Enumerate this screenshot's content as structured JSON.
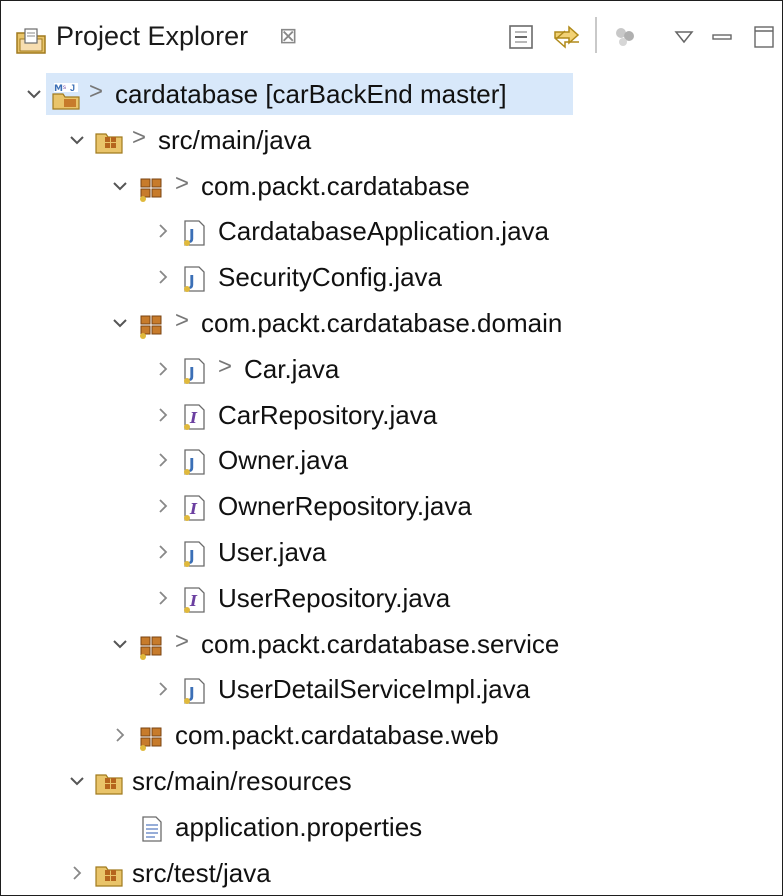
{
  "view": {
    "title": "Project Explorer",
    "close_glyph": "⊠",
    "toolbar": {
      "collapse_all": "collapse-all-icon",
      "link_with_editor": "link-with-editor-icon",
      "filters": "filters-icon",
      "view_menu": "view-menu-icon",
      "minimize": "minimize-icon",
      "maximize": "maximize-icon"
    }
  },
  "tree": {
    "rows": [
      {
        "label": "cardatabase [carBackEnd master]",
        "decoration": ">",
        "icon": "maven-project-icon",
        "expanded": true
      },
      {
        "label": "src/main/java",
        "decoration": ">",
        "icon": "source-folder-icon",
        "expanded": true
      },
      {
        "label": "com.packt.cardatabase",
        "decoration": ">",
        "icon": "package-icon",
        "expanded": true
      },
      {
        "label": "CardatabaseApplication.java",
        "decoration": "",
        "icon": "java-class-icon",
        "expanded": false
      },
      {
        "label": "SecurityConfig.java",
        "decoration": "",
        "icon": "java-class-icon",
        "expanded": false
      },
      {
        "label": "com.packt.cardatabase.domain",
        "decoration": ">",
        "icon": "package-icon",
        "expanded": true
      },
      {
        "label": "Car.java",
        "decoration": ">",
        "icon": "java-class-icon",
        "expanded": false
      },
      {
        "label": "CarRepository.java",
        "decoration": "",
        "icon": "java-interface-icon",
        "expanded": false
      },
      {
        "label": "Owner.java",
        "decoration": "",
        "icon": "java-class-icon",
        "expanded": false
      },
      {
        "label": "OwnerRepository.java",
        "decoration": "",
        "icon": "java-interface-icon",
        "expanded": false
      },
      {
        "label": "User.java",
        "decoration": "",
        "icon": "java-class-icon",
        "expanded": false
      },
      {
        "label": "UserRepository.java",
        "decoration": "",
        "icon": "java-interface-icon",
        "expanded": false
      },
      {
        "label": "com.packt.cardatabase.service",
        "decoration": ">",
        "icon": "package-icon",
        "expanded": true
      },
      {
        "label": "UserDetailServiceImpl.java",
        "decoration": "",
        "icon": "java-class-icon",
        "expanded": false
      },
      {
        "label": "com.packt.cardatabase.web",
        "decoration": "",
        "icon": "package-icon",
        "expanded": false
      },
      {
        "label": "src/main/resources",
        "decoration": "",
        "icon": "source-folder-icon",
        "expanded": true
      },
      {
        "label": "application.properties",
        "decoration": "",
        "icon": "properties-file-icon",
        "expanded": false
      },
      {
        "label": "src/test/java",
        "decoration": "",
        "icon": "source-folder-icon",
        "expanded": false
      }
    ]
  },
  "colors": {
    "selection": "#d8e8fa",
    "border": "#1e1e1e",
    "chevron": "#555555",
    "package_brown": "#b5651d",
    "jar_gold": "#d9a531",
    "java_blue": "#3b6fb6",
    "interface_purple": "#6b3fa0"
  }
}
